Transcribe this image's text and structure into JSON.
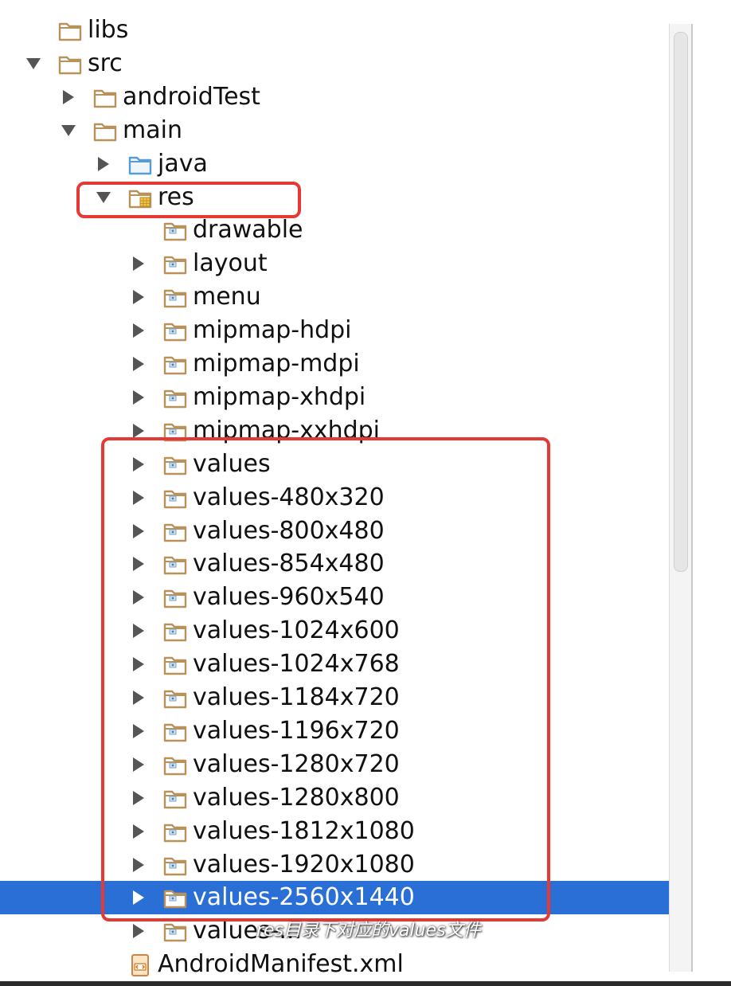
{
  "tree": {
    "rows": [
      {
        "label": "libs",
        "depth": 0,
        "arrow": "none",
        "icon": "folder-plain-icon",
        "selected": false
      },
      {
        "label": "src",
        "depth": 0,
        "arrow": "down",
        "icon": "folder-plain-icon",
        "selected": false
      },
      {
        "label": "androidTest",
        "depth": 1,
        "arrow": "right",
        "icon": "folder-plain-icon",
        "selected": false
      },
      {
        "label": "main",
        "depth": 1,
        "arrow": "down",
        "icon": "folder-plain-icon",
        "selected": false
      },
      {
        "label": "java",
        "depth": 2,
        "arrow": "right",
        "icon": "source-folder-icon",
        "selected": false
      },
      {
        "label": "res",
        "depth": 2,
        "arrow": "down",
        "icon": "resource-folder-icon",
        "selected": false
      },
      {
        "label": "drawable",
        "depth": 3,
        "arrow": "none",
        "icon": "package-folder-icon",
        "selected": false
      },
      {
        "label": "layout",
        "depth": 3,
        "arrow": "right",
        "icon": "package-folder-icon",
        "selected": false
      },
      {
        "label": "menu",
        "depth": 3,
        "arrow": "right",
        "icon": "package-folder-icon",
        "selected": false
      },
      {
        "label": "mipmap-hdpi",
        "depth": 3,
        "arrow": "right",
        "icon": "package-folder-icon",
        "selected": false
      },
      {
        "label": "mipmap-mdpi",
        "depth": 3,
        "arrow": "right",
        "icon": "package-folder-icon",
        "selected": false
      },
      {
        "label": "mipmap-xhdpi",
        "depth": 3,
        "arrow": "right",
        "icon": "package-folder-icon",
        "selected": false
      },
      {
        "label": "mipmap-xxhdpi",
        "depth": 3,
        "arrow": "right",
        "icon": "package-folder-icon",
        "selected": false
      },
      {
        "label": "values",
        "depth": 3,
        "arrow": "right",
        "icon": "package-folder-icon",
        "selected": false
      },
      {
        "label": "values-480x320",
        "depth": 3,
        "arrow": "right",
        "icon": "package-folder-icon",
        "selected": false
      },
      {
        "label": "values-800x480",
        "depth": 3,
        "arrow": "right",
        "icon": "package-folder-icon",
        "selected": false
      },
      {
        "label": "values-854x480",
        "depth": 3,
        "arrow": "right",
        "icon": "package-folder-icon",
        "selected": false
      },
      {
        "label": "values-960x540",
        "depth": 3,
        "arrow": "right",
        "icon": "package-folder-icon",
        "selected": false
      },
      {
        "label": "values-1024x600",
        "depth": 3,
        "arrow": "right",
        "icon": "package-folder-icon",
        "selected": false
      },
      {
        "label": "values-1024x768",
        "depth": 3,
        "arrow": "right",
        "icon": "package-folder-icon",
        "selected": false
      },
      {
        "label": "values-1184x720",
        "depth": 3,
        "arrow": "right",
        "icon": "package-folder-icon",
        "selected": false
      },
      {
        "label": "values-1196x720",
        "depth": 3,
        "arrow": "right",
        "icon": "package-folder-icon",
        "selected": false
      },
      {
        "label": "values-1280x720",
        "depth": 3,
        "arrow": "right",
        "icon": "package-folder-icon",
        "selected": false
      },
      {
        "label": "values-1280x800",
        "depth": 3,
        "arrow": "right",
        "icon": "package-folder-icon",
        "selected": false
      },
      {
        "label": "values-1812x1080",
        "depth": 3,
        "arrow": "right",
        "icon": "package-folder-icon",
        "selected": false
      },
      {
        "label": "values-1920x1080",
        "depth": 3,
        "arrow": "right",
        "icon": "package-folder-icon",
        "selected": false
      },
      {
        "label": "values-2560x1440",
        "depth": 3,
        "arrow": "right",
        "icon": "package-folder-icon",
        "selected": true
      },
      {
        "label": "values-...",
        "depth": 3,
        "arrow": "right",
        "icon": "package-folder-icon",
        "selected": false
      },
      {
        "label": "AndroidManifest.xml",
        "depth": 2,
        "arrow": "none",
        "icon": "xml-file-icon",
        "selected": false
      }
    ]
  },
  "caption": "res目录下对应的values文件",
  "colors": {
    "selection": "#2a6fd6",
    "highlight_box": "#e53935",
    "folder": "#c9a36b"
  }
}
